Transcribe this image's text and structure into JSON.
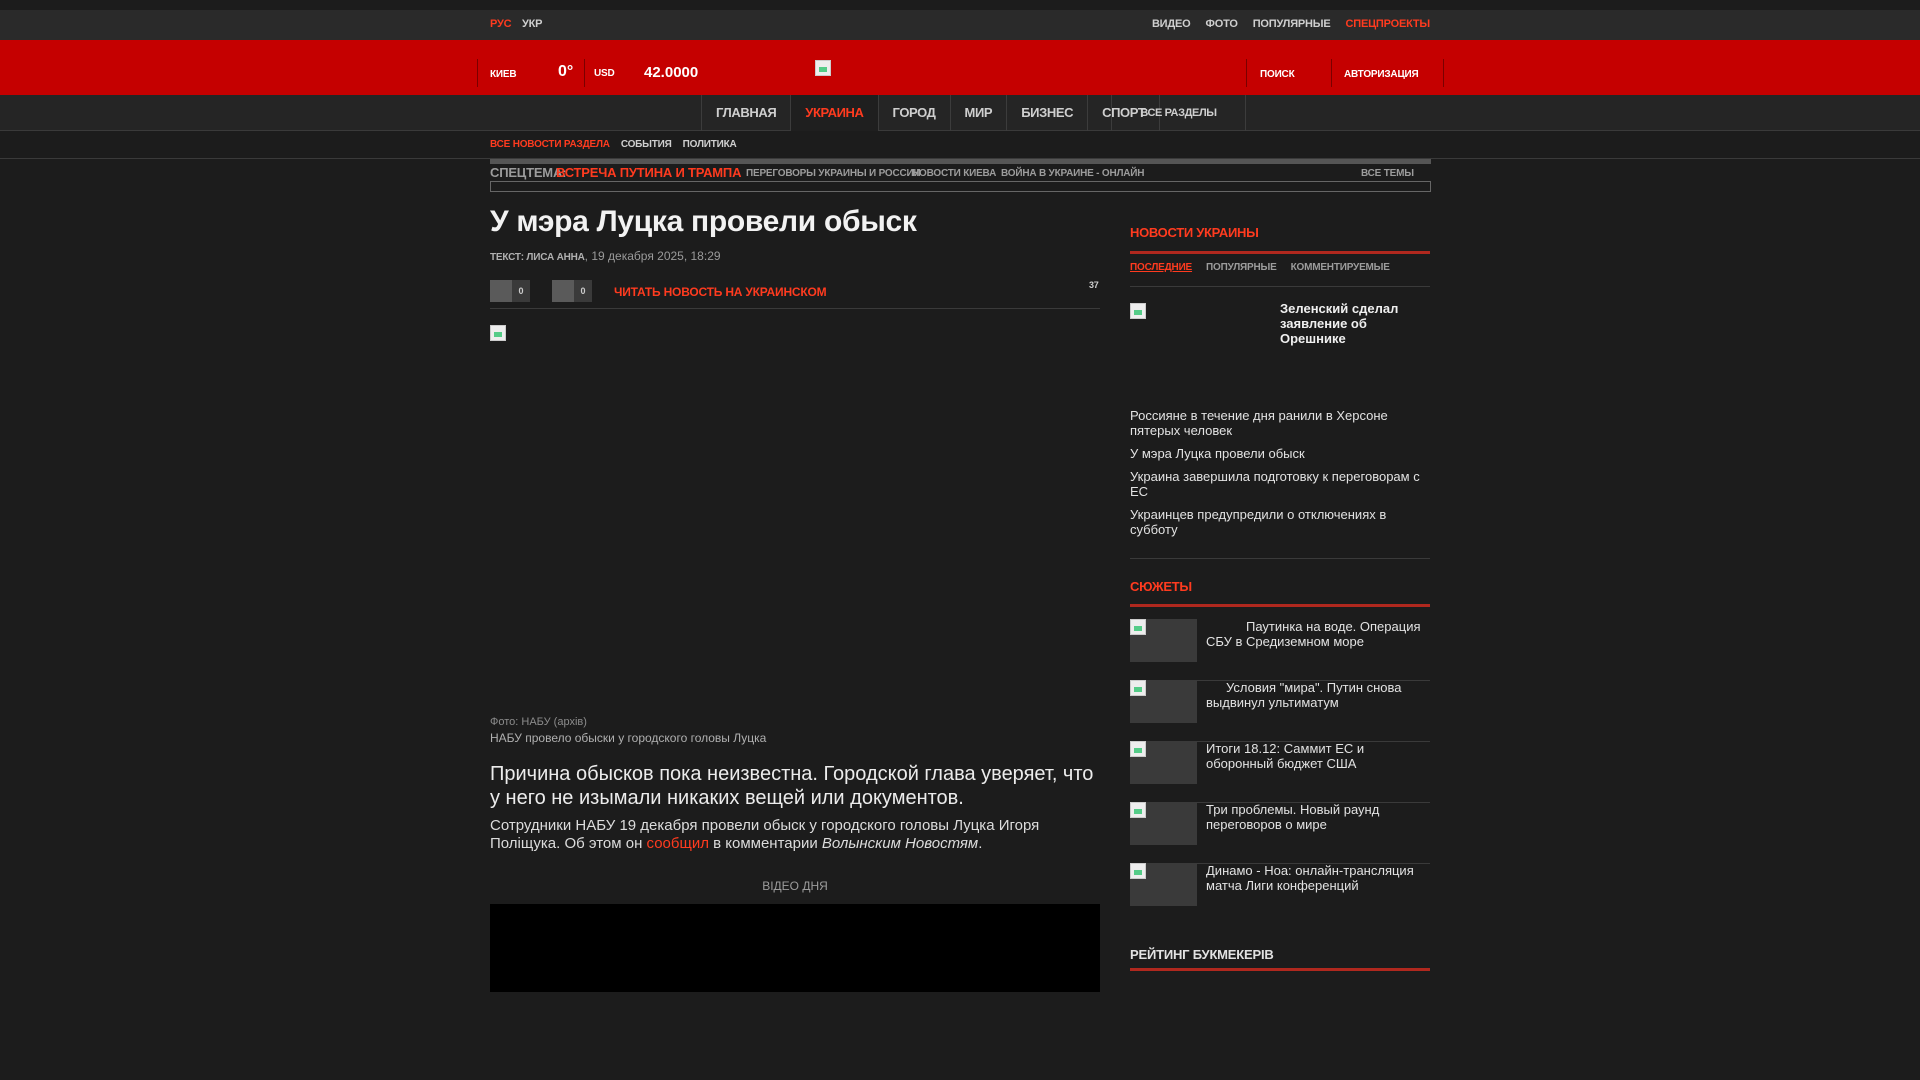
{
  "utility": {
    "lang_ru": "РУС",
    "lang_uk": "УКР",
    "links": [
      "ВИДЕО",
      "ФОТО",
      "ПОПУЛЯРНЫЕ",
      "СПЕЦПРОЕКТЫ"
    ]
  },
  "header": {
    "city": "КИЕВ",
    "temperature": "0°",
    "currency": "USD",
    "rate": "42.0000",
    "search": "ПОИСК",
    "auth": "АВТОРИЗАЦИЯ"
  },
  "nav": {
    "items": [
      "ГЛАВНАЯ",
      "УКРАИНА",
      "ГОРОД",
      "МИР",
      "БИЗНЕС",
      "СПОРТ"
    ],
    "active": "УКРАИНА",
    "all_sections": "ВСЕ РАЗДЕЛЫ"
  },
  "subnav": {
    "items": [
      "ВСЕ НОВОСТИ РАЗДЕЛА",
      "СОБЫТИЯ",
      "ПОЛИТИКА"
    ]
  },
  "spec": {
    "label": "СПЕЦТЕМА:",
    "highlight": "ВСТРЕЧА ПУТИНА И ТРАМПА",
    "topics": [
      "ПЕРЕГОВОРЫ УКРАИНЫ И РОССИИ",
      "НОВОСТИ КИЕВА",
      "ВОЙНА В УКРАИНЕ - ОНЛАЙН"
    ],
    "all_topics": "ВСЕ ТЕМЫ"
  },
  "article": {
    "title": "У мэра Луцка провели обыск",
    "author": "ТЕКСТ: ЛИСА АННА",
    "date": "19 декабря 2025, 18:29",
    "like_count": "0",
    "dislike_count": "0",
    "read_ukrainian": "ЧИТАТЬ НОВОСТЬ НА УКРАИНСКОМ",
    "views": "37",
    "photo_credit": "Фото: НАБУ (архів)",
    "photo_caption": "НАБУ провело обыски у городского головы Луцка",
    "lead": "Причина обысков пока неизвестна. Городской глава уверяет, что у него не изымали никаких вещей или документов.",
    "body_before": "Сотрудники НАБУ 19 декабря провели обыск у городского головы Луцка Игоря Полiщука. Об этом он ",
    "body_link": "сообщил",
    "body_middle": " в комментарии ",
    "body_source": "Волынским Новостям",
    "body_end": ".",
    "video_label": "ВIДЕО ДНЯ"
  },
  "sidebar": {
    "ukraine_news_title": "НОВОСТИ УКРАИНЫ",
    "tabs": [
      "ПОСЛЕДНИЕ",
      "ПОПУЛЯРНЫЕ",
      "КОММЕНТИРУЕМЫЕ"
    ],
    "featured": "Зеленский сделал заявление об Орешнике",
    "news": [
      "Россияне в течение дня ранили в Херсоне пятерых человек",
      "У мэра Луцка провели обыск",
      "Украина завершила подготовку к переговорам с ЕС",
      "Украинцев предупредили о отключениях в субботу"
    ],
    "stories_title": "СЮЖЕТЫ",
    "stories": [
      "Паутинка на воде. Операция СБУ в Средиземном море",
      "Условия \"мира\". Путин снова выдвинул ультиматум",
      "Итоги 18.12: Саммит ЕС и оборонный бюджет США",
      "Три проблемы. Новый раунд переговоров о мире",
      "Динамо - Ноа: онлайн-трансляция матча Лиги конференций"
    ],
    "rating_title": "РЕЙТИНГ БУКМЕКЕРIВ"
  },
  "colors": {
    "accent": "#ff3b1f",
    "header_red": "#c50000",
    "background": "#1c1c1c"
  }
}
